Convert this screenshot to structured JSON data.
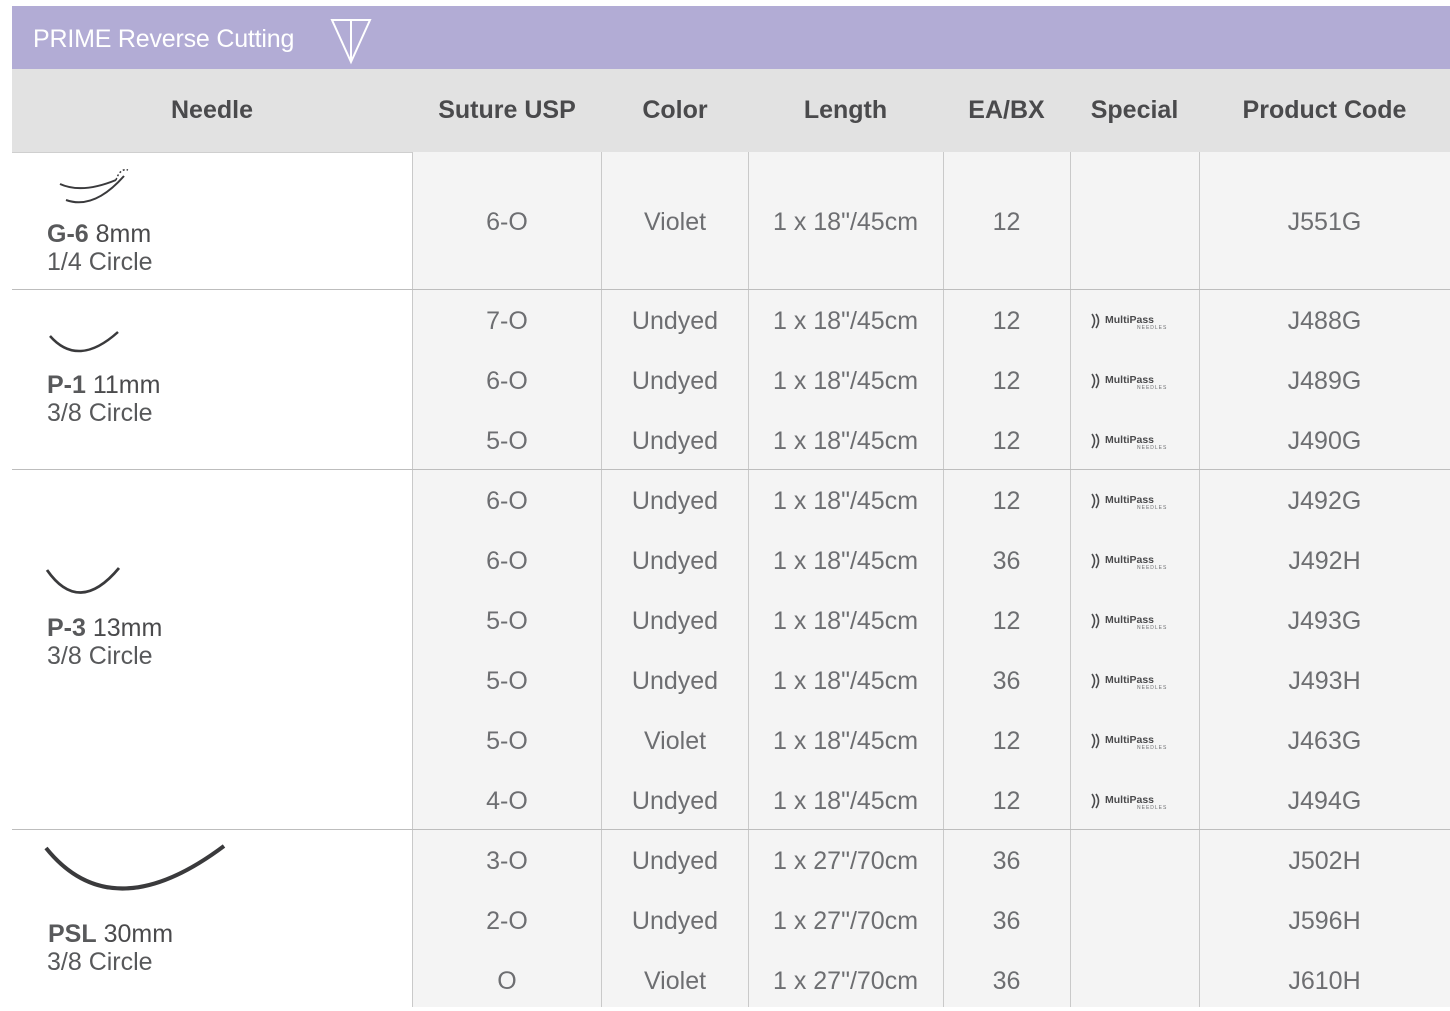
{
  "banner": {
    "title": "PRIME Reverse Cutting",
    "icon": "reverse-cutting-triangle-icon"
  },
  "columns": [
    "Needle",
    "Suture USP",
    "Color",
    "Length",
    "EA/BX",
    "Special",
    "Product Code"
  ],
  "groups": [
    {
      "needle": {
        "name": "G-6",
        "size": "8mm",
        "curve": "1/4 Circle",
        "icon": "g6-needle-icon"
      },
      "rows": [
        {
          "usp": "6-O",
          "color": "Violet",
          "length": "1 x 18\"/45cm",
          "eabx": "12",
          "special": "",
          "code": "J551G"
        }
      ]
    },
    {
      "needle": {
        "name": "P-1",
        "size": "11mm",
        "curve": "3/8 Circle",
        "icon": "p1-needle-icon"
      },
      "rows": [
        {
          "usp": "7-O",
          "color": "Undyed",
          "length": "1 x 18\"/45cm",
          "eabx": "12",
          "special": "MultiPass",
          "code": "J488G"
        },
        {
          "usp": "6-O",
          "color": "Undyed",
          "length": "1 x 18\"/45cm",
          "eabx": "12",
          "special": "MultiPass",
          "code": "J489G"
        },
        {
          "usp": "5-O",
          "color": "Undyed",
          "length": "1 x 18\"/45cm",
          "eabx": "12",
          "special": "MultiPass",
          "code": "J490G"
        }
      ]
    },
    {
      "needle": {
        "name": "P-3",
        "size": "13mm",
        "curve": "3/8 Circle",
        "icon": "p3-needle-icon"
      },
      "rows": [
        {
          "usp": "6-O",
          "color": "Undyed",
          "length": "1 x 18\"/45cm",
          "eabx": "12",
          "special": "MultiPass",
          "code": "J492G"
        },
        {
          "usp": "6-O",
          "color": "Undyed",
          "length": "1 x 18\"/45cm",
          "eabx": "36",
          "special": "MultiPass",
          "code": "J492H"
        },
        {
          "usp": "5-O",
          "color": "Undyed",
          "length": "1 x 18\"/45cm",
          "eabx": "12",
          "special": "MultiPass",
          "code": "J493G"
        },
        {
          "usp": "5-O",
          "color": "Undyed",
          "length": "1 x 18\"/45cm",
          "eabx": "36",
          "special": "MultiPass",
          "code": "J493H"
        },
        {
          "usp": "5-O",
          "color": "Violet",
          "length": "1 x 18\"/45cm",
          "eabx": "12",
          "special": "MultiPass",
          "code": "J463G"
        },
        {
          "usp": "4-O",
          "color": "Undyed",
          "length": "1 x 18\"/45cm",
          "eabx": "12",
          "special": "MultiPass",
          "code": "J494G"
        }
      ]
    },
    {
      "needle": {
        "name": "PSL",
        "size": "30mm",
        "curve": "3/8 Circle",
        "icon": "psl-needle-icon"
      },
      "rows": [
        {
          "usp": "3-O",
          "color": "Undyed",
          "length": "1 x 27\"/70cm",
          "eabx": "36",
          "special": "",
          "code": "J502H"
        },
        {
          "usp": "2-O",
          "color": "Undyed",
          "length": "1 x 27\"/70cm",
          "eabx": "36",
          "special": "",
          "code": "J596H"
        },
        {
          "usp": "O",
          "color": "Violet",
          "length": "1 x 27\"/70cm",
          "eabx": "36",
          "special": "",
          "code": "J610H"
        }
      ]
    }
  ],
  "multipass": {
    "brand": "MultiPass",
    "sub": "NEEDLES"
  },
  "colors": {
    "banner": "#b2acd5",
    "header": "#e2e2e2",
    "body": "#f4f4f4",
    "text": "#58595b"
  }
}
